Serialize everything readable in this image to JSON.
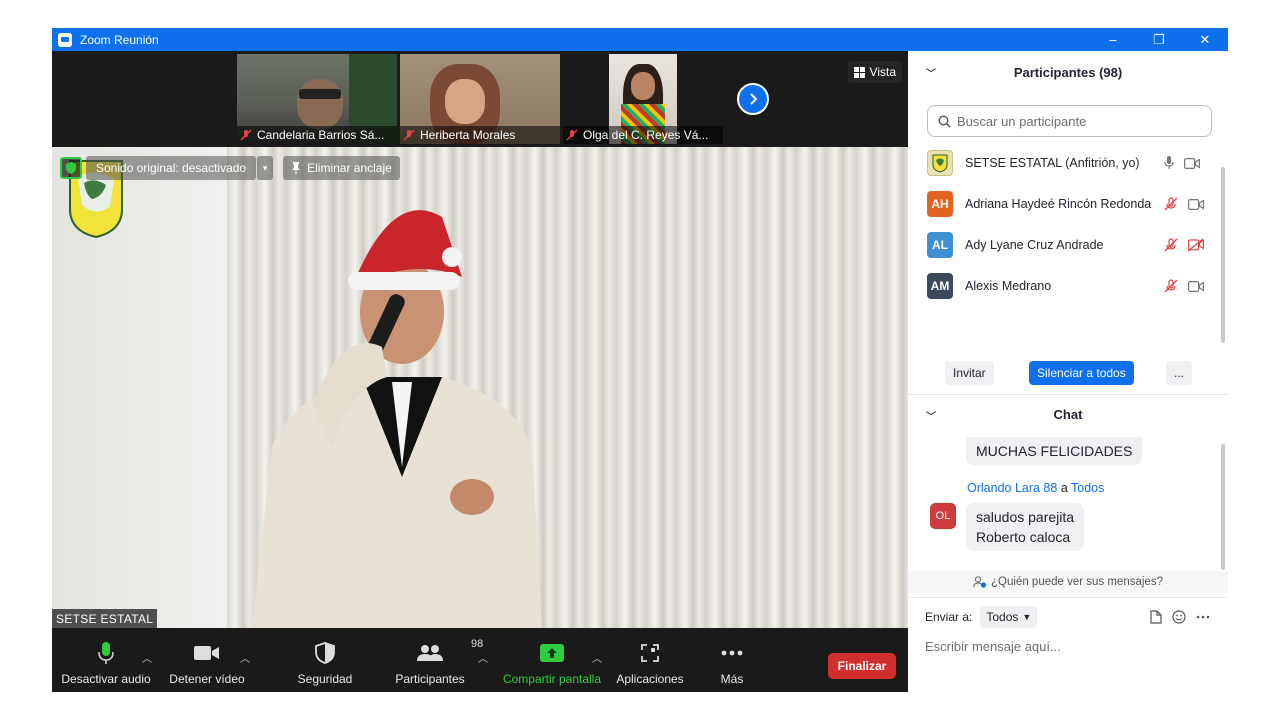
{
  "window": {
    "title": "Zoom Reunión",
    "minimize": "–",
    "restore": "❐",
    "close": "✕"
  },
  "thumbnails": [
    {
      "name": "Candelaria Barrios Sá..."
    },
    {
      "name": "Heriberta Morales"
    },
    {
      "name": "Olga del C. Reyes Vá..."
    }
  ],
  "view_button": {
    "label": "Vista"
  },
  "stage": {
    "original_sound": "Sonido original: desactivado",
    "unpin": "Eliminar anclaje",
    "speaker_name": "SETSE ESTATAL"
  },
  "toolbar": {
    "mute": "Desactivar audio",
    "video": "Detener vídeo",
    "security": "Seguridad",
    "participants": "Participantes",
    "participants_count": "98",
    "share": "Compartir pantalla",
    "apps": "Aplicaciones",
    "more": "Más",
    "end": "Finalizar"
  },
  "participants_panel": {
    "title": "Participantes (98)",
    "search_placeholder": "Buscar un participante",
    "items": [
      {
        "initials": "",
        "name": "SETSE ESTATAL (Anfitrión, yo)",
        "color": "#e8e3b0"
      },
      {
        "initials": "AH",
        "name": "Adriana Haydeé Rincón Redonda",
        "color": "#e0641f"
      },
      {
        "initials": "AL",
        "name": "Ady Lyane Cruz Andrade",
        "color": "#3f8fd2"
      },
      {
        "initials": "AM",
        "name": "Alexis Medrano",
        "color": "#3d4a5c"
      }
    ],
    "invite": "Invitar",
    "mute_all": "Silenciar a todos",
    "more": "..."
  },
  "chat": {
    "title": "Chat",
    "prev_message": "MUCHAS FELICIDADES",
    "message": {
      "avatar": "OL",
      "sender": "Orlando Lara 88",
      "to_word": "a",
      "recipient": "Todos",
      "line1": "saludos parejita",
      "line2": "Roberto caloca"
    },
    "who_sees": "¿Quién puede ver sus mensajes?",
    "send_to_label": "Enviar a:",
    "send_to_value": "Todos",
    "input_placeholder": "Escribir mensaje aquí..."
  }
}
